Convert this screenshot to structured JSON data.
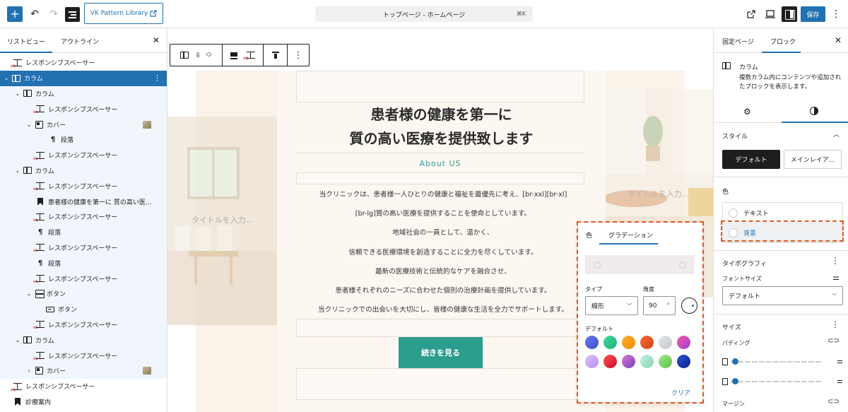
{
  "topbar": {
    "vk_button": "VK Pattern Library",
    "doc_title": "トップページ - ホームページ",
    "shortcut": "⌘K",
    "save": "保存"
  },
  "left_panel": {
    "tabs": [
      "リストビュー",
      "アウトライン"
    ],
    "items": [
      {
        "label": "レスポンシブスペーサー",
        "icon": "spacer-icon"
      },
      {
        "label": "カラム",
        "icon": "columns-icon"
      },
      {
        "label": "カラム",
        "icon": "column-icon"
      },
      {
        "label": "レスポンシブスペーサー",
        "icon": "spacer-icon"
      },
      {
        "label": "カバー",
        "icon": "cover-icon"
      },
      {
        "label": "段落",
        "icon": "paragraph-icon"
      },
      {
        "label": "レスポンシブスペーサー",
        "icon": "spacer-icon"
      },
      {
        "label": "カラム",
        "icon": "column-icon"
      },
      {
        "label": "レスポンシブスペーサー",
        "icon": "spacer-icon"
      },
      {
        "label": "患者様の健康を第一に 質の高い医...",
        "icon": "heading-icon"
      },
      {
        "label": "レスポンシブスペーサー",
        "icon": "spacer-icon"
      },
      {
        "label": "段落",
        "icon": "paragraph-icon"
      },
      {
        "label": "レスポンシブスペーサー",
        "icon": "spacer-icon"
      },
      {
        "label": "段落",
        "icon": "paragraph-icon"
      },
      {
        "label": "レスポンシブスペーサー",
        "icon": "spacer-icon"
      },
      {
        "label": "ボタン",
        "icon": "buttons-icon"
      },
      {
        "label": "ボタン",
        "icon": "button-icon"
      },
      {
        "label": "レスポンシブスペーサー",
        "icon": "spacer-icon"
      },
      {
        "label": "カラム",
        "icon": "column-icon"
      },
      {
        "label": "レスポンシブスペーサー",
        "icon": "spacer-icon"
      },
      {
        "label": "カバー",
        "icon": "cover-icon"
      },
      {
        "label": "レスポンシブスペーサー",
        "icon": "spacer-icon"
      },
      {
        "label": "診療案内",
        "icon": "bookmark-icon"
      }
    ]
  },
  "canvas": {
    "hero_title_line1": "患者様の健康を第一に",
    "hero_title_line2": "質の高い医療を提供致します",
    "about": "About US",
    "image_placeholder": "タイトルを入力...",
    "body_lines": [
      "当クリニックは、患者様一人ひとりの健康と福祉を最優先に考え、[br-xxl][br-xl]",
      "[br-lg]質の高い医療を提供することを使命としています。",
      "地域社会の一員として、温かく、",
      "信頼できる医療環境を創造することに全力を尽くしています。",
      "最新の医療技術と伝統的なケアを融合させ、",
      "患者様それぞれのニーズに合わせた個別の治療計画を提供しています。",
      "当クリニックでの出会いを大切にし、皆様の健康な生活を全力でサポートします。"
    ],
    "cta": "続きを見る"
  },
  "popover": {
    "tab_color": "色",
    "tab_gradient": "グラデーション",
    "type_label": "タイプ",
    "type_value": "線形",
    "angle_label": "角度",
    "angle_value": "90",
    "angle_unit": "°",
    "default_label": "デフォルト",
    "clear": "クリア",
    "swatches": [
      "#5b6ee1",
      "#2ecc8f",
      "#f39c12",
      "#e4561e",
      "#d5d8dc",
      "#e84393",
      "#c9a7f5",
      "#e8243c",
      "#9b59b6",
      "#a8e6cf",
      "#7bd96b",
      "#1d3bb5"
    ]
  },
  "right_panel": {
    "tabs": [
      "固定ページ",
      "ブロック"
    ],
    "block_name": "カラム",
    "block_desc": "複数カラム内にコンテンツや追加されたブロックを表示します。",
    "style_title": "スタイル",
    "style_default": "デフォルト",
    "style_main": "メインレイア...",
    "color_title": "色",
    "color_text": "テキスト",
    "color_bg": "背景",
    "typography_title": "タイポグラフィ",
    "font_size_label": "フォントサイズ",
    "font_size_value": "デフォルト",
    "size_title": "サイズ",
    "padding_label": "パディング",
    "margin_label": "マージン"
  },
  "colors": {
    "accent": "#2271b1",
    "teal": "#2a9d8f",
    "highlight": "#e4561e"
  }
}
